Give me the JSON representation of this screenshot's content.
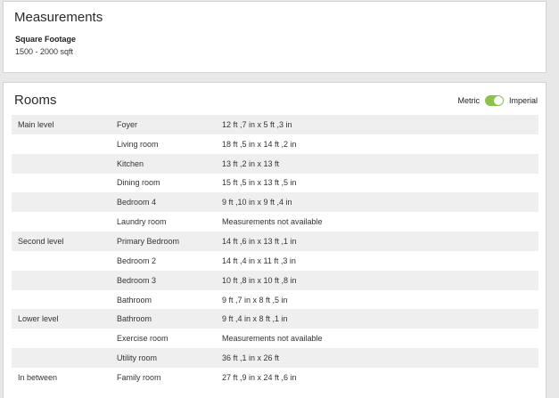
{
  "measurements": {
    "title": "Measurements",
    "square_footage_label": "Square Footage",
    "square_footage_value": "1500 - 2000 sqft"
  },
  "rooms": {
    "title": "Rooms",
    "toggle": {
      "left_label": "Metric",
      "right_label": "Imperial",
      "selected": "Imperial",
      "color": "#8bc34a"
    },
    "rows": [
      {
        "level": "Main level",
        "room": "Foyer",
        "dimensions": "12 ft ,7 in x 5 ft ,3 in"
      },
      {
        "level": "",
        "room": "Living room",
        "dimensions": "18 ft ,5 in x 14 ft ,2 in"
      },
      {
        "level": "",
        "room": "Kitchen",
        "dimensions": "13 ft ,2 in x 13 ft"
      },
      {
        "level": "",
        "room": "Dining room",
        "dimensions": "15 ft ,5 in x 13 ft ,5 in"
      },
      {
        "level": "",
        "room": "Bedroom 4",
        "dimensions": "9 ft ,10 in x 9 ft ,4 in"
      },
      {
        "level": "",
        "room": "Laundry room",
        "dimensions": "Measurements not available"
      },
      {
        "level": "Second level",
        "room": "Primary Bedroom",
        "dimensions": "14 ft ,6 in x 13 ft ,1 in"
      },
      {
        "level": "",
        "room": "Bedroom 2",
        "dimensions": "14 ft ,4 in x 11 ft ,3 in"
      },
      {
        "level": "",
        "room": "Bedroom 3",
        "dimensions": "10 ft ,8 in x 10 ft ,8 in"
      },
      {
        "level": "",
        "room": "Bathroom",
        "dimensions": "9 ft ,7 in x 8 ft ,5 in"
      },
      {
        "level": "Lower level",
        "room": "Bathroom",
        "dimensions": "9 ft ,4 in x 8 ft ,1 in"
      },
      {
        "level": "",
        "room": "Exercise room",
        "dimensions": "Measurements not available"
      },
      {
        "level": "",
        "room": "Utility room",
        "dimensions": "36 ft ,1 in x 26 ft"
      },
      {
        "level": "In between",
        "room": "Family room",
        "dimensions": "27 ft ,9 in x 24 ft ,6 in"
      }
    ]
  }
}
